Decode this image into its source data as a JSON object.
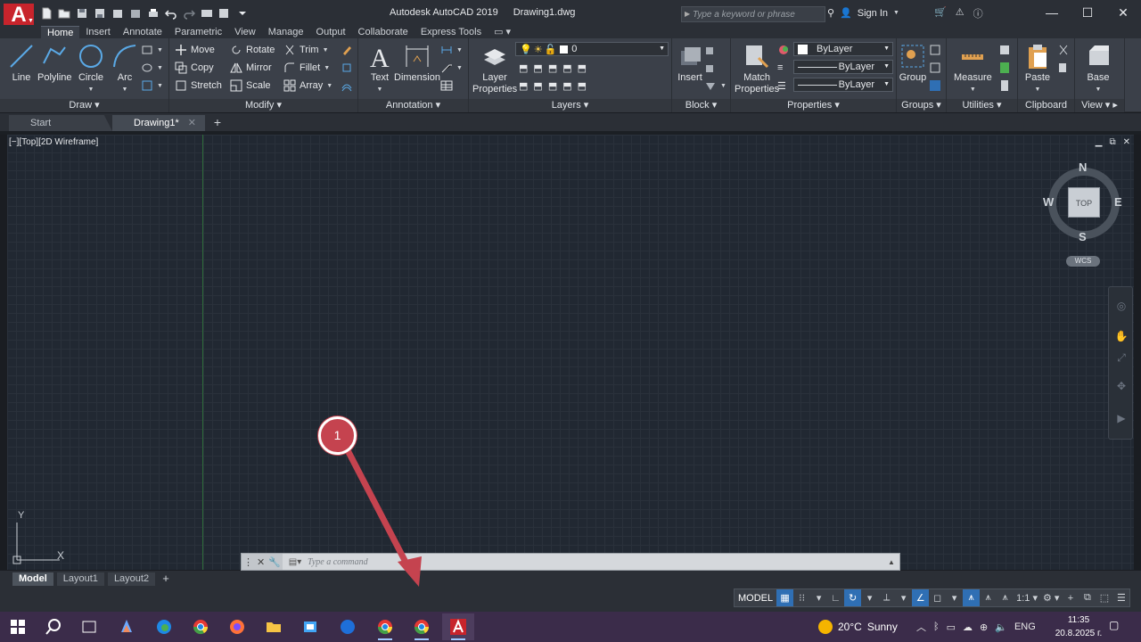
{
  "title_bar": {
    "app_name": "Autodesk AutoCAD 2019",
    "file_name": "Drawing1.dwg",
    "app_logo": "A",
    "search_placeholder": "Type a keyword or phrase",
    "sign_in": "Sign In"
  },
  "ribbon_tabs": [
    "Home",
    "Insert",
    "Annotate",
    "Parametric",
    "View",
    "Manage",
    "Output",
    "Collaborate",
    "Express Tools"
  ],
  "ribbon": {
    "draw": {
      "title": "Draw",
      "line": "Line",
      "polyline": "Polyline",
      "circle": "Circle",
      "arc": "Arc"
    },
    "modify": {
      "title": "Modify",
      "move": "Move",
      "rotate": "Rotate",
      "trim": "Trim",
      "copy": "Copy",
      "mirror": "Mirror",
      "fillet": "Fillet",
      "stretch": "Stretch",
      "scale": "Scale",
      "array": "Array"
    },
    "annotation": {
      "title": "Annotation",
      "text": "Text",
      "dimension": "Dimension"
    },
    "layers": {
      "title": "Layers",
      "layer_properties_1": "Layer",
      "layer_properties_2": "Properties",
      "current_layer": "0"
    },
    "block": {
      "title": "Block",
      "insert": "Insert"
    },
    "properties": {
      "title": "Properties",
      "match_1": "Match",
      "match_2": "Properties",
      "color": "ByLayer",
      "linetype": "ByLayer",
      "lineweight": "ByLayer"
    },
    "groups": {
      "title": "Groups",
      "group": "Group"
    },
    "utilities": {
      "title": "Utilities",
      "measure": "Measure"
    },
    "clipboard": {
      "title": "Clipboard",
      "paste": "Paste"
    },
    "view": {
      "title": "View",
      "base": "Base"
    }
  },
  "doc_tabs": {
    "start": "Start",
    "drawing": "Drawing1*"
  },
  "viewport": {
    "label": "[−][Top][2D Wireframe]",
    "viewcube": {
      "n": "N",
      "s": "S",
      "e": "E",
      "w": "W",
      "face": "TOP"
    },
    "wcs": "WCS",
    "ucs_x": "X",
    "ucs_y": "Y"
  },
  "command_line": {
    "placeholder": "Type a command"
  },
  "layout_tabs": [
    "Model",
    "Layout1",
    "Layout2"
  ],
  "status_bar": {
    "model": "MODEL",
    "scale": "1:1"
  },
  "annotation": {
    "badge": "1",
    "color": "#c5434f"
  },
  "taskbar": {
    "weather_temp": "20°C",
    "weather_desc": "Sunny",
    "lang": "ENG",
    "time": "11:35",
    "date": "20.8.2025 г."
  },
  "colors": {
    "accent_blue": "#2f6fb4",
    "autocad_red": "#c8242c",
    "canvas": "#212832"
  }
}
